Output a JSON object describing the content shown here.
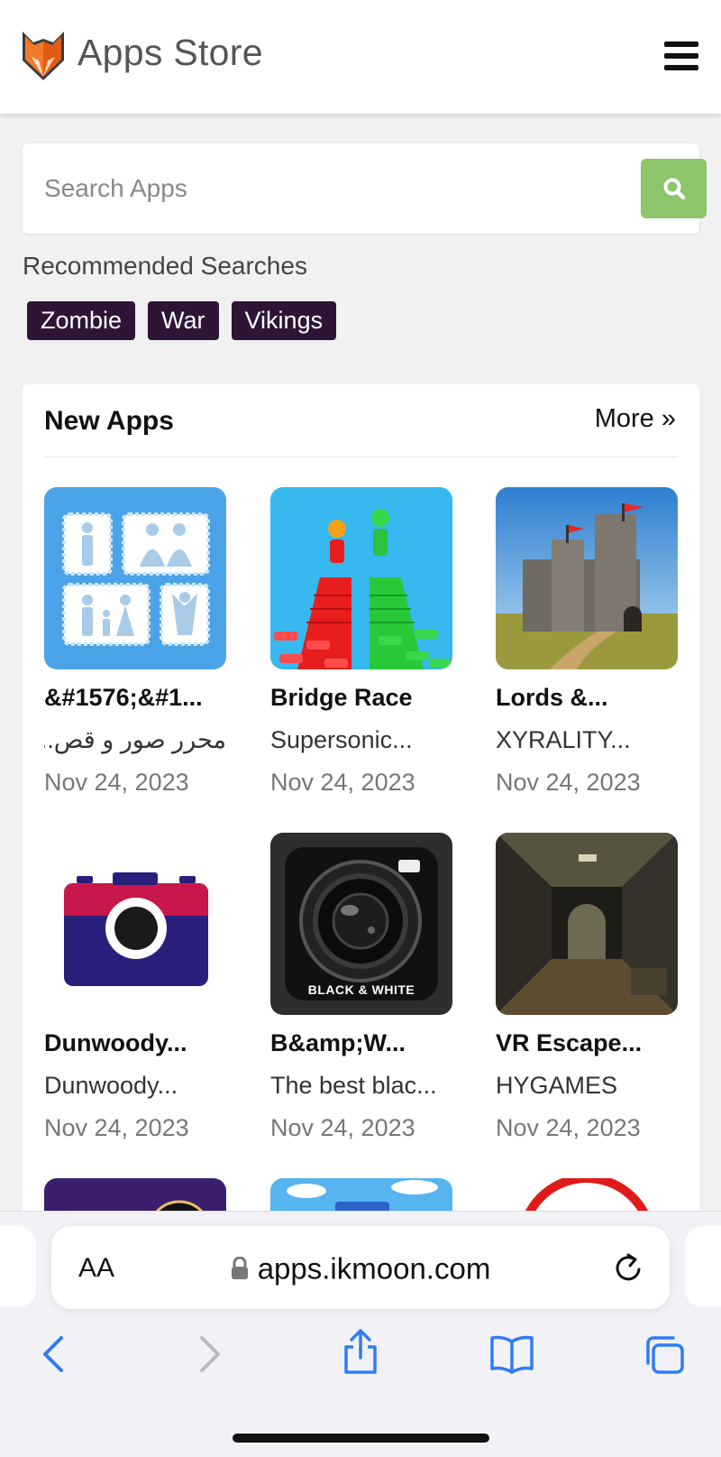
{
  "header": {
    "brand": "Apps Store"
  },
  "search": {
    "placeholder": "Search Apps"
  },
  "recommended": {
    "label": "Recommended Searches",
    "tags": [
      "Zombie",
      "War",
      "Vikings"
    ]
  },
  "new_apps": {
    "title": "New Apps",
    "more": "More »",
    "apps": [
      {
        "name": "&#1576;&#1...",
        "developer": "محرر صور و قص...",
        "date": "Nov 24, 2023"
      },
      {
        "name": "Bridge Race",
        "developer": "Supersonic...",
        "date": "Nov 24, 2023"
      },
      {
        "name": "Lords &...",
        "developer": "XYRALITY...",
        "date": "Nov 24, 2023"
      },
      {
        "name": "Dunwoody...",
        "developer": "Dunwoody...",
        "date": "Nov 24, 2023"
      },
      {
        "name": "B&amp;W...",
        "developer": "The best blac...",
        "date": "Nov 24, 2023"
      },
      {
        "name": "VR Escape...",
        "developer": "HYGAMES",
        "date": "Nov 24, 2023"
      }
    ],
    "icon_labels": {
      "bw_camera": "BLACK & WHITE"
    }
  },
  "browser": {
    "aa": "AA",
    "url": "apps.ikmoon.com"
  },
  "colors": {
    "accent_green": "#8cc56a",
    "tag_bg": "#2e1535",
    "safari_blue": "#2f7cf6"
  }
}
